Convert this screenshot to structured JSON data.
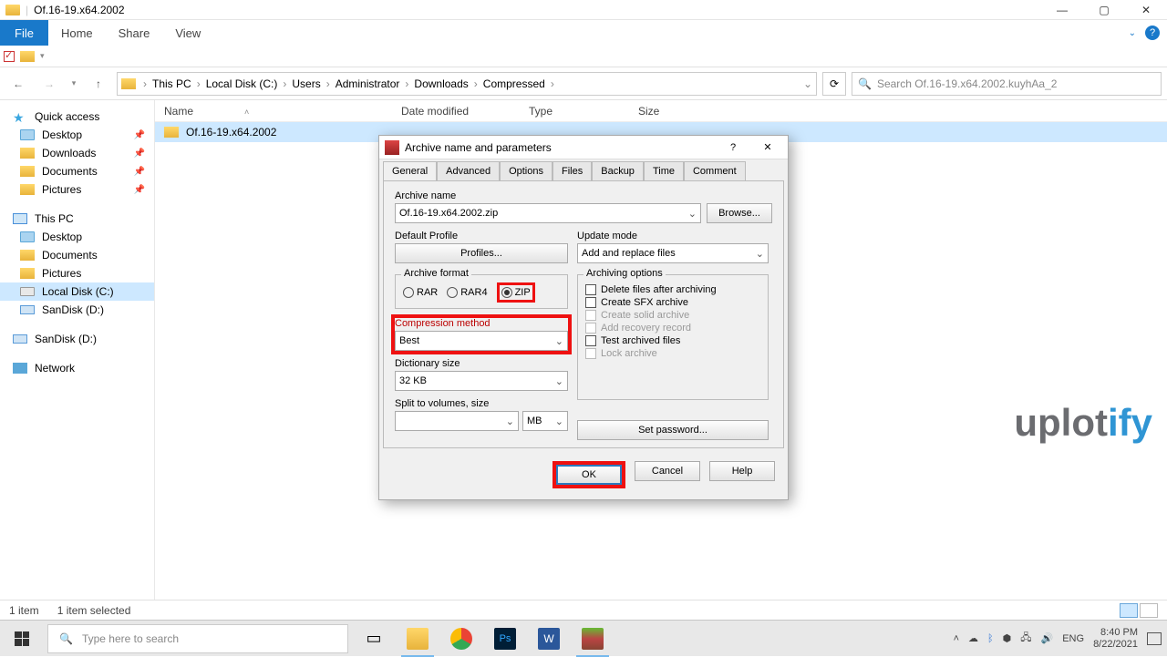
{
  "titlebar": {
    "title": "Of.16-19.x64.2002"
  },
  "ribbon": {
    "file": "File",
    "tabs": [
      "Home",
      "Share",
      "View"
    ]
  },
  "breadcrumb": [
    "This PC",
    "Local Disk (C:)",
    "Users",
    "Administrator",
    "Downloads",
    "Compressed"
  ],
  "search": {
    "placeholder": "Search Of.16-19.x64.2002.kuyhAa_2"
  },
  "columns": {
    "name": "Name",
    "date": "Date modified",
    "type": "Type",
    "size": "Size"
  },
  "filerow": {
    "name": "Of.16-19.x64.2002"
  },
  "sidebar": {
    "quick": "Quick access",
    "quick_items": [
      "Desktop",
      "Downloads",
      "Documents",
      "Pictures"
    ],
    "thispc": "This PC",
    "pc_items": [
      "Desktop",
      "Documents",
      "Pictures",
      "Local Disk (C:)",
      "SanDisk (D:)"
    ],
    "sandisk": "SanDisk (D:)",
    "network": "Network"
  },
  "watermark": {
    "a": "uplot",
    "b": "ify"
  },
  "status": {
    "items": "1 item",
    "selected": "1 item selected"
  },
  "taskbar": {
    "search": "Type here to search",
    "time": "8:40 PM",
    "date": "8/22/2021"
  },
  "dialog": {
    "title": "Archive name and parameters",
    "tabs": [
      "General",
      "Advanced",
      "Options",
      "Files",
      "Backup",
      "Time",
      "Comment"
    ],
    "archive_name_lbl": "Archive name",
    "archive_name": "Of.16-19.x64.2002.zip",
    "browse": "Browse...",
    "default_profile": "Default Profile",
    "profiles": "Profiles...",
    "update_mode_lbl": "Update mode",
    "update_mode": "Add and replace files",
    "archive_format": "Archive format",
    "fmt": {
      "rar": "RAR",
      "rar4": "RAR4",
      "zip": "ZIP"
    },
    "comp_method_lbl": "Compression method",
    "comp_method": "Best",
    "dict_lbl": "Dictionary size",
    "dict": "32 KB",
    "split_lbl": "Split to volumes, size",
    "split_unit": "MB",
    "arch_opts": "Archiving options",
    "opts": {
      "del": "Delete files after archiving",
      "sfx": "Create SFX archive",
      "solid": "Create solid archive",
      "recov": "Add recovery record",
      "test": "Test archived files",
      "lock": "Lock archive"
    },
    "setpw": "Set password...",
    "ok": "OK",
    "cancel": "Cancel",
    "help": "Help"
  }
}
